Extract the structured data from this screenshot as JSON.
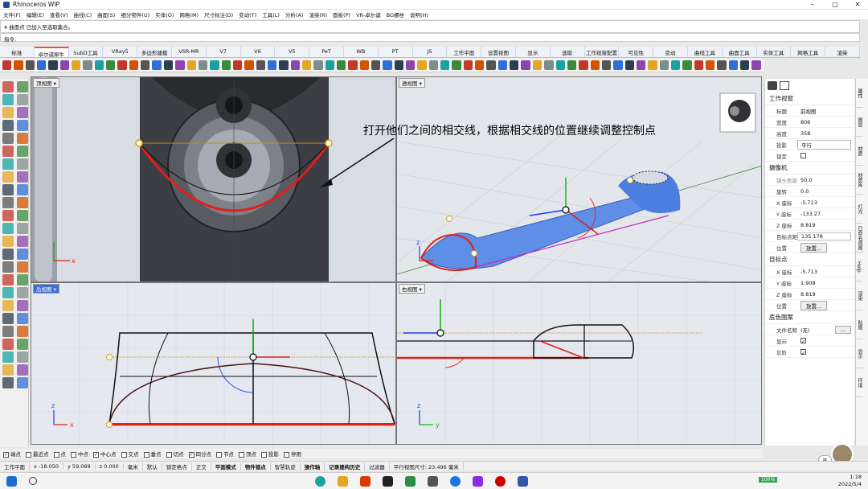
{
  "window": {
    "title": "Rhinoceros WIP",
    "min": "–",
    "max": "▢",
    "close": "✕"
  },
  "menu": [
    "文件(F)",
    "编辑(E)",
    "查看(V)",
    "曲线(C)",
    "曲面(S)",
    "细分物件(U)",
    "实体(O)",
    "网格(M)",
    "尺寸标注(D)",
    "变动(T)",
    "工具(L)",
    "分析(A)",
    "渲染(R)",
    "面板(P)",
    "VR-卓尔谟",
    "BG螺栓",
    "说明(H)"
  ],
  "command_history": "4 曲面点 已加入至选取集合。",
  "command_prompt": "指令:",
  "tabs": [
    "标准",
    "卓尔谟犀牛",
    "SubD工具",
    "VRay5",
    "多边形建模",
    "VSR-MR",
    "V7",
    "V6",
    "V5",
    "PeT",
    "WB",
    "PT",
    "JS",
    "工作平面",
    "设置视图",
    "显示",
    "选取",
    "工作视窗配置",
    "可见性",
    "变动",
    "曲线工具",
    "曲面工具",
    "实体工具",
    "网格工具",
    "渲染"
  ],
  "active_tab": "卓尔谟犀牛",
  "annotation": "打开他们之间的相交线，根据相交线的位置继续调整控制点",
  "viewports": {
    "top": {
      "label": "顶视图 ▾"
    },
    "perspective": {
      "label": "透视图 ▾"
    },
    "back": {
      "label": "后视图 ▾"
    },
    "right": {
      "label": "右视图 ▾"
    }
  },
  "axes": {
    "x": "x",
    "y": "y",
    "z": "z"
  },
  "panel": {
    "section_view": "工作视窗",
    "title_k": "标题",
    "title_v": "前视图",
    "width_k": "宽度",
    "width_v": "806",
    "height_k": "高度",
    "height_v": "358",
    "proj_k": "投影",
    "proj_v": "平行",
    "lock_k": "锁定",
    "section_camera": "摄像机",
    "lens_k": "镜头焦距...",
    "lens_v": "50.0",
    "rot_k": "旋转",
    "rot_v": "0.0",
    "cx_k": "X 座标",
    "cx_v": "-5.713",
    "cy_k": "Y 座标",
    "cy_v": "-133.27",
    "cz_k": "Z 座标",
    "cz_v": "8.819",
    "dist_k": "目标点距离",
    "dist_v": "135.178",
    "pos_k": "位置",
    "place_btn": "放置...",
    "section_target": "目标点",
    "tx_k": "X 座标",
    "tx_v": "-5.713",
    "ty_k": "Y 座标",
    "ty_v": "1.908",
    "tz_k": "Z 座标",
    "tz_v": "8.819",
    "tpos_k": "位置",
    "tplace_btn": "放置...",
    "section_bg": "底色图案",
    "file_k": "文件名称",
    "file_v": "(无)",
    "file_btn": "...",
    "show_k": "显示",
    "gray_k": "灰阶"
  },
  "vtabs": [
    "属性",
    "图层",
    "材质",
    "材质库",
    "灯光",
    "已命名视图",
    "Help",
    "渲染",
    "贴图",
    "显示",
    "环境"
  ],
  "osnap": [
    "端点",
    "最近点",
    "点",
    "中点",
    "中心点",
    "交点",
    "垂点",
    "切点",
    "四分点",
    "节点",
    "顶点",
    "投影",
    "停用"
  ],
  "osnap_checked": [
    true,
    false,
    false,
    false,
    true,
    false,
    false,
    false,
    true,
    false,
    false,
    false,
    false
  ],
  "status": {
    "cplane": "工作平面",
    "x": "x -18.050",
    "y": "y 59.069",
    "z": "z 0.000",
    "unit": "毫米",
    "layer": "默认",
    "items": [
      "锁定格点",
      "正交",
      "平面模式",
      "物件锁点",
      "智慧轨迹",
      "操作轴",
      "记录建构历史",
      "过滤器",
      "平行视图尺寸: 23.496 毫米"
    ]
  },
  "taskbar": {
    "time": "1:18",
    "date": "2022/5/4",
    "battery": "100%",
    "ime": "英"
  },
  "colors": {
    "accent": "#3a6fd8",
    "curve_red": "#e0201a",
    "gizmo_blue": "#1a3ef0",
    "gizmo_green": "#1cb31c"
  }
}
